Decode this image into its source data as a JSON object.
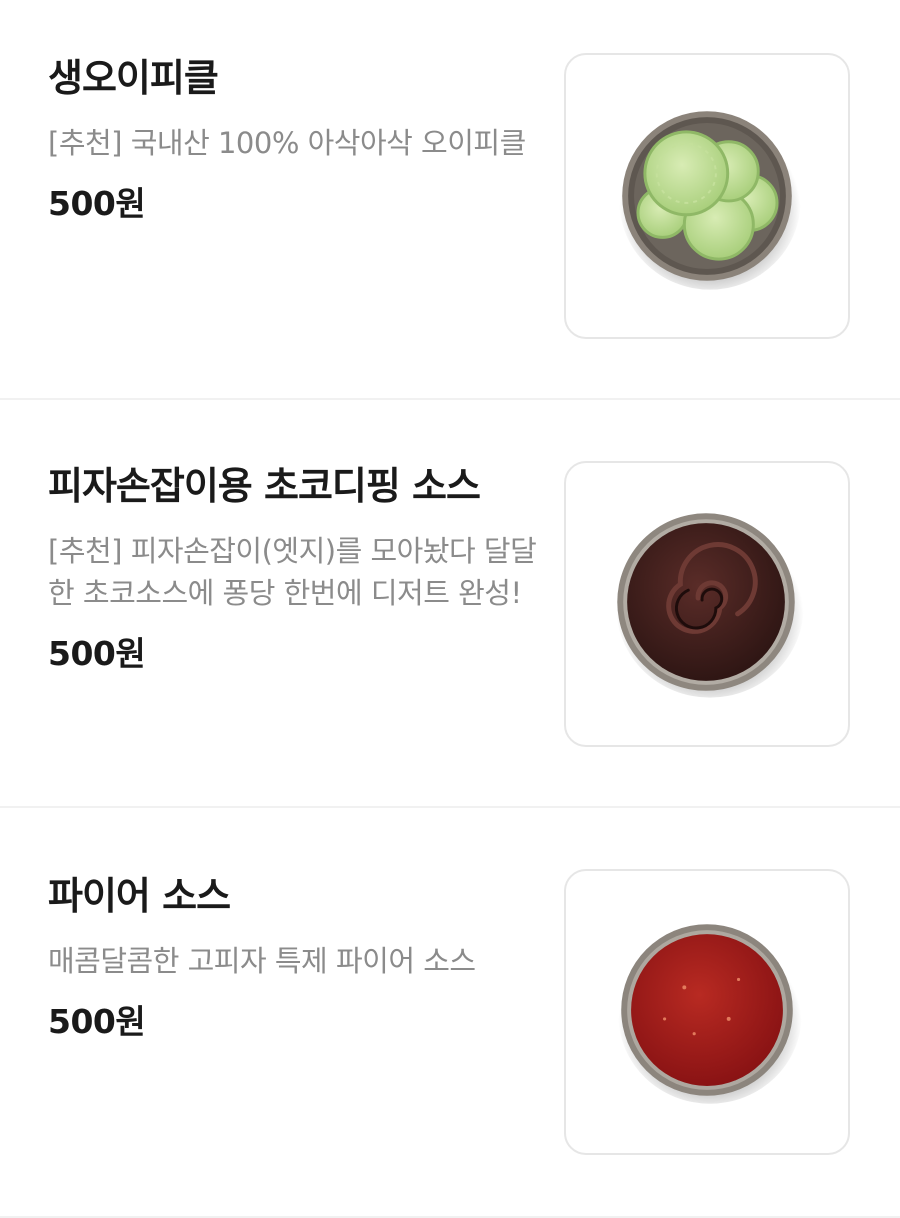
{
  "menu": {
    "items": [
      {
        "name": "생오이피클",
        "description": "[추천] 국내산 100% 아삭아삭 오이피클",
        "price": "500원",
        "image": "cucumber-pickle-bowl"
      },
      {
        "name": "피자손잡이용 초코디핑 소스",
        "description": "[추천] 피자손잡이(엣지)를 모아놨다 달달한 초코소스에 퐁당 한번에 디저트 완성!",
        "price": "500원",
        "image": "chocolate-dipping-sauce-bowl"
      },
      {
        "name": "파이어 소스",
        "description": "매콤달콤한 고피자 특제 파이어 소스",
        "price": "500원",
        "image": "fire-sauce-bowl"
      }
    ]
  },
  "colors": {
    "text": "#1a1a1a",
    "description": "#8b8b8b",
    "divider": "#f1f1f1",
    "thumb_border": "#e6e6e6",
    "pickle": "#b9d98f",
    "chocolate": "#3d1f1c",
    "fire_sauce": "#a0181a"
  }
}
